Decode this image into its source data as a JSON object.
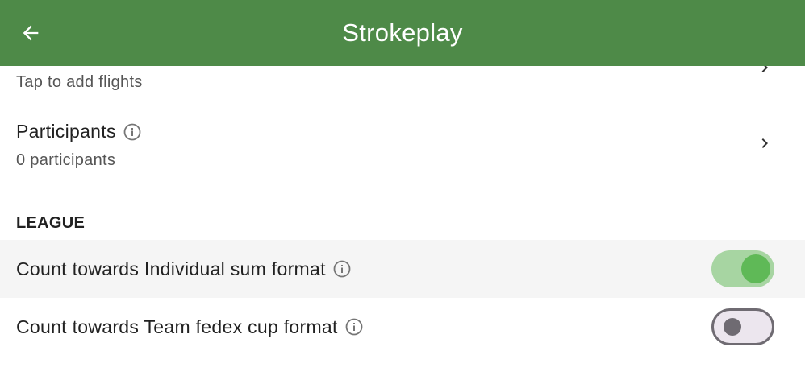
{
  "appbar": {
    "title": "Strokeplay",
    "back_icon": "arrow-left-icon",
    "color": "#4e8a48"
  },
  "flights": {
    "subtitle": "Tap to add flights"
  },
  "participants": {
    "title": "Participants",
    "subtitle": "0 participants"
  },
  "league": {
    "header": "LEAGUE",
    "settings": [
      {
        "label": "Count towards Individual sum format",
        "enabled": true
      },
      {
        "label": "Count towards Team fedex cup format",
        "enabled": false
      }
    ]
  },
  "colors": {
    "toggle_on_track": "#a7d5a2",
    "toggle_on_knob": "#5fb957",
    "toggle_off_track": "#ece6ee",
    "toggle_off_outline": "#6f6b72"
  }
}
